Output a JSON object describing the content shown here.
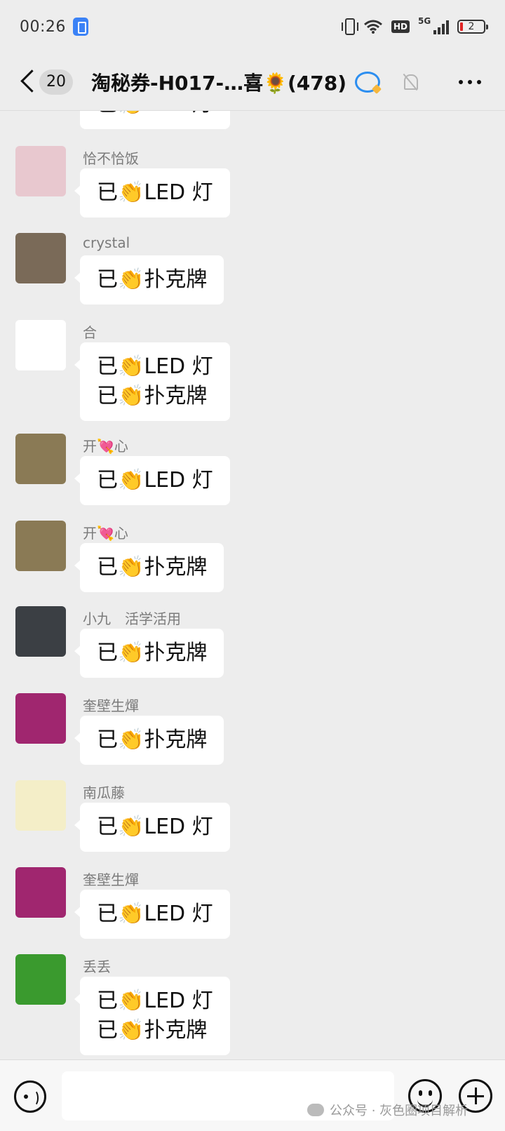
{
  "status_bar": {
    "time": "00:26",
    "network": "5G",
    "hd": "HD",
    "battery": "2"
  },
  "header": {
    "unread_count": "20",
    "title": "淘秘券-H017-…喜🌻(478)"
  },
  "messages": [
    {
      "sender": "",
      "lines": [
        "已👏LED 灯"
      ],
      "avatar": "avatar-partial",
      "color": "#ffffff"
    },
    {
      "sender": "恰不恰饭",
      "lines": [
        "已👏LED 灯"
      ],
      "avatar": "cartoon-avatar",
      "color": "#e8c8cf"
    },
    {
      "sender": "crystal",
      "lines": [
        "已👏扑克牌"
      ],
      "avatar": "photo-avatar",
      "color": "#7a6a58"
    },
    {
      "sender": "合",
      "lines": [
        "已👏LED 灯",
        "已👏扑克牌"
      ],
      "avatar": "smiley-avatar",
      "color": "#ffffff"
    },
    {
      "sender": "开💘心",
      "lines": [
        "已👏LED 灯"
      ],
      "avatar": "ring-avatar",
      "color": "#8a7a55"
    },
    {
      "sender": "开💘心",
      "lines": [
        "已👏扑克牌"
      ],
      "avatar": "ring-avatar",
      "color": "#8a7a55"
    },
    {
      "sender": "小九　活学活用",
      "lines": [
        "已👏扑克牌"
      ],
      "avatar": "anime-avatar",
      "color": "#3b3f44"
    },
    {
      "sender": "奎壁生燀",
      "lines": [
        "已👏扑克牌"
      ],
      "avatar": "flower-avatar",
      "color": "#a0266f"
    },
    {
      "sender": "南瓜藤",
      "lines": [
        "已👏LED 灯"
      ],
      "avatar": "logo-avatar",
      "color": "#f4eec8"
    },
    {
      "sender": "奎壁生燀",
      "lines": [
        "已👏LED 灯"
      ],
      "avatar": "flower-avatar",
      "color": "#a0266f"
    },
    {
      "sender": "丢丢",
      "lines": [
        "已👏LED 灯",
        "已👏扑克牌"
      ],
      "avatar": "clover-avatar",
      "color": "#3a9a2e"
    }
  ],
  "bottom_bar": {
    "input_value": "",
    "watermark": "公众号 · 灰色圈项目解析"
  }
}
